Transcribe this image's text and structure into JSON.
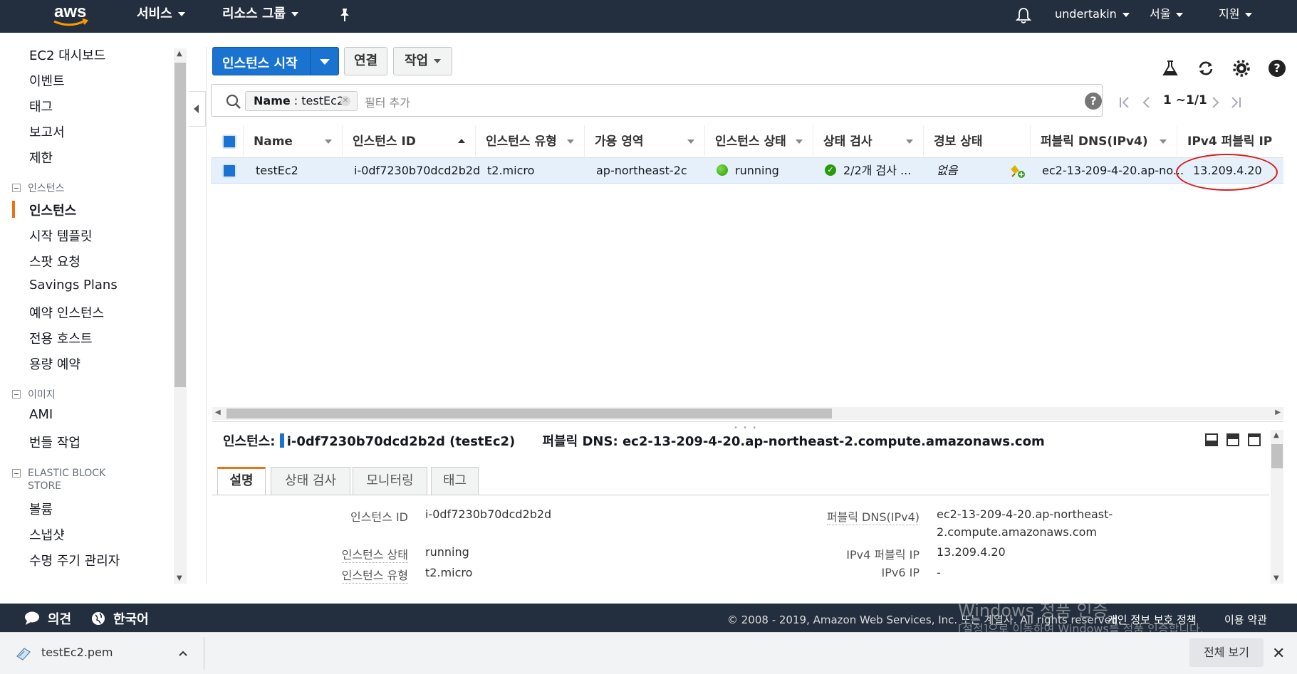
{
  "topnav": {
    "logo_text": "aws",
    "services": "서비스",
    "resource_groups": "리소스 그룹",
    "username": "undertakin",
    "region": "서울",
    "support": "지원"
  },
  "sidebar": {
    "items_top": [
      "EC2 대시보드",
      "이벤트",
      "태그",
      "보고서",
      "제한"
    ],
    "group_instances": "인스턴스",
    "items_instances": [
      "인스턴스",
      "시작 템플릿",
      "스팟 요청",
      "Savings Plans",
      "예약 인스턴스",
      "전용 호스트",
      "용량 예약"
    ],
    "group_images": "이미지",
    "items_images": [
      "AMI",
      "번들 작업"
    ],
    "group_ebs_line1": "ELASTIC BLOCK",
    "group_ebs_line2": "STORE",
    "items_ebs": [
      "볼륨",
      "스냅샷",
      "수명 주기 관리자"
    ]
  },
  "toolbar": {
    "launch_label": "인스턴스 시작",
    "connect_label": "연결",
    "actions_label": "작업"
  },
  "filter": {
    "token_key": "Name",
    "token_sep": " : ",
    "token_value": "testEc2",
    "placeholder": "필터 추가",
    "help": "?"
  },
  "pager": {
    "range": "1 ~1/1"
  },
  "table": {
    "columns": [
      "Name",
      "인스턴스 ID",
      "인스턴스 유형",
      "가용 영역",
      "인스턴스 상태",
      "상태 검사",
      "경보 상태",
      "퍼블릭 DNS(IPv4)",
      "IPv4 퍼블릭 IP"
    ],
    "rows": [
      {
        "name": "testEc2",
        "instance_id": "i-0df7230b70dcd2b2d",
        "type": "t2.micro",
        "az": "ap-northeast-2c",
        "state": "running",
        "status_check": "2/2개 검사 ...",
        "alarm": "없음",
        "public_dns": "ec2-13-209-4-20.ap-no...",
        "public_ip": "13.209.4.20"
      }
    ]
  },
  "detail": {
    "title_prefix": "인스턴스:",
    "title_id": "i-0df7230b70dcd2b2d (testEc2)",
    "dns_prefix": "퍼블릭 DNS:",
    "dns_value": "ec2-13-209-4-20.ap-northeast-2.compute.amazonaws.com",
    "tabs": [
      "설명",
      "상태 검사",
      "모니터링",
      "태그"
    ],
    "left_labels": [
      "인스턴스 ID",
      "인스턴스 상태",
      "인스턴스 유형"
    ],
    "left_values": [
      "i-0df7230b70dcd2b2d",
      "running",
      "t2.micro"
    ],
    "right_labels": [
      "퍼블릭 DNS(IPv4)",
      "IPv4 퍼블릭 IP",
      "IPv6 IP"
    ],
    "right_values": [
      "ec2-13-209-4-20.ap-northeast-",
      "2.compute.amazonaws.com",
      "13.209.4.20",
      "-"
    ]
  },
  "footer": {
    "feedback": "의견",
    "language": "한국어",
    "copyright": "© 2008 - 2019, Amazon Web Services, Inc. 또는 계열사. All rights reserved.",
    "privacy": "개인 정보 보호 정책",
    "terms": "이용 약관",
    "watermark_line1": "Windows 정품 인증",
    "watermark_line2": "[설정]으로 이동하여 Windows를 정품 인증합니다."
  },
  "downloads": {
    "filename": "testEc2.pem",
    "show_all": "전체 보기"
  },
  "colors": {
    "nav_bg": "#232f3e",
    "primary": "#1a73d0",
    "accent": "#ec7211",
    "running": "#2a9a0c",
    "annotation": "#d81b1b"
  }
}
